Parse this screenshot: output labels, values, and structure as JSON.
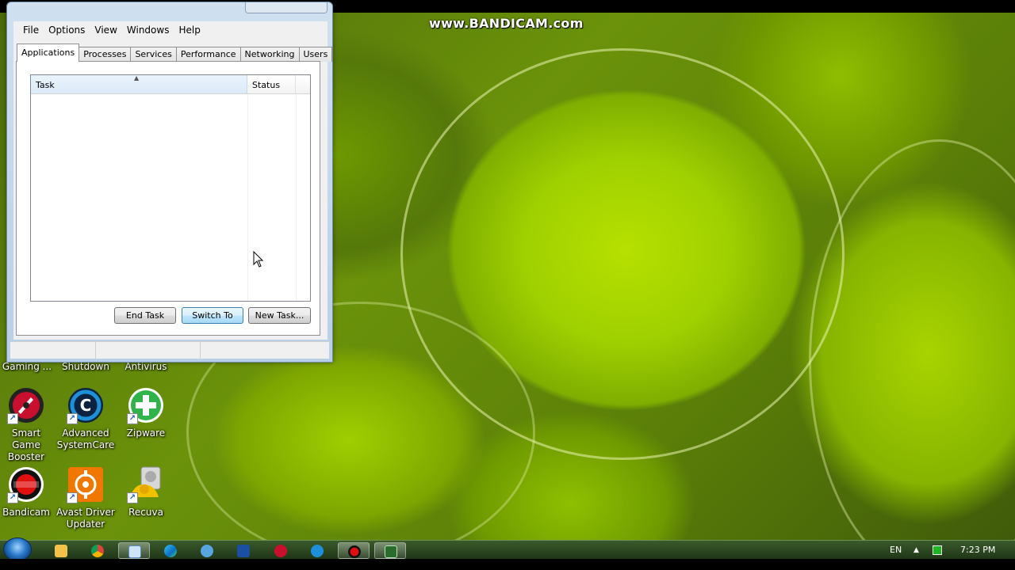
{
  "watermark": "www.BANDICAM.com",
  "task_manager": {
    "menu": [
      "File",
      "Options",
      "View",
      "Windows",
      "Help"
    ],
    "tabs": [
      "Applications",
      "Processes",
      "Services",
      "Performance",
      "Networking",
      "Users"
    ],
    "active_tab": "Applications",
    "columns": {
      "task": "Task",
      "status": "Status"
    },
    "buttons": {
      "end_task": "End Task",
      "switch_to": "Switch To",
      "new_task": "New Task..."
    }
  },
  "desktop_icons": {
    "partial_labels": [
      "Gaming ...",
      "Shutdown",
      "Antivirus"
    ],
    "items": [
      {
        "label_line1": "Smart Game",
        "label_line2": "Booster",
        "icon": "smart-game-booster-icon",
        "color": "#c8102e"
      },
      {
        "label_line1": "Advanced",
        "label_line2": "SystemCare",
        "icon": "advanced-systemcare-icon",
        "color": "#1e90d8"
      },
      {
        "label_line1": "Zipware",
        "label_line2": "",
        "icon": "zipware-icon",
        "color": "#2fb34a"
      },
      {
        "label_line1": "Bandicam",
        "label_line2": "",
        "icon": "bandicam-icon",
        "color": "#e01010"
      },
      {
        "label_line1": "Avast Driver",
        "label_line2": "Updater",
        "icon": "avast-driver-updater-icon",
        "color": "#f07800"
      },
      {
        "label_line1": "Recuva",
        "label_line2": "",
        "icon": "recuva-icon",
        "color": "#f2c200"
      }
    ]
  },
  "taskbar": {
    "items": [
      "start-orb-icon",
      "file-explorer-icon",
      "chrome-icon",
      "keyboard-icon",
      "edge-icon",
      "network-icon",
      "app-icon",
      "smart-game-booster-icon",
      "advanced-systemcare-icon",
      "bandicam-icon",
      "task-manager-icon"
    ],
    "language": "EN",
    "time": "7:23 PM"
  }
}
